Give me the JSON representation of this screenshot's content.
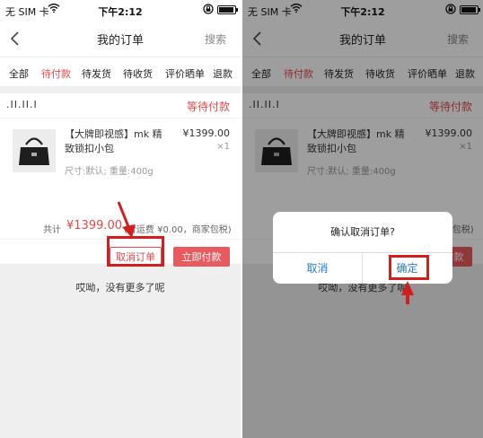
{
  "status_bar": {
    "carrier": "无 SIM 卡",
    "time": "下午2:12",
    "battery_level": 0.95
  },
  "nav": {
    "title": "我的订单",
    "search": "搜索"
  },
  "tabs": [
    "全部",
    "待付款",
    "待发货",
    "待收货",
    "评价晒单",
    "退款"
  ],
  "active_tab": "待付款",
  "order": {
    "shop": ".II.II.I",
    "status": "等待付款",
    "product_name": "【大牌即视感】mk 精致锁扣小包",
    "price": "¥1399.00",
    "qty": "×1",
    "spec": "尺寸:默认; 重量:400g",
    "total_label": "共计",
    "total_amount": "¥1399.00",
    "total_note": "(含运费 ¥0.00，商家包税)",
    "cancel_label": "取消订单",
    "pay_label": "立即付款"
  },
  "no_more": "哎呦，没有更多了呢",
  "dialog": {
    "message": "确认取消订单?",
    "cancel": "取消",
    "confirm": "确定"
  },
  "colors": {
    "accent": "#e2484d",
    "annotation": "#d21e1e",
    "dialog_button": "#2a7ccf"
  }
}
